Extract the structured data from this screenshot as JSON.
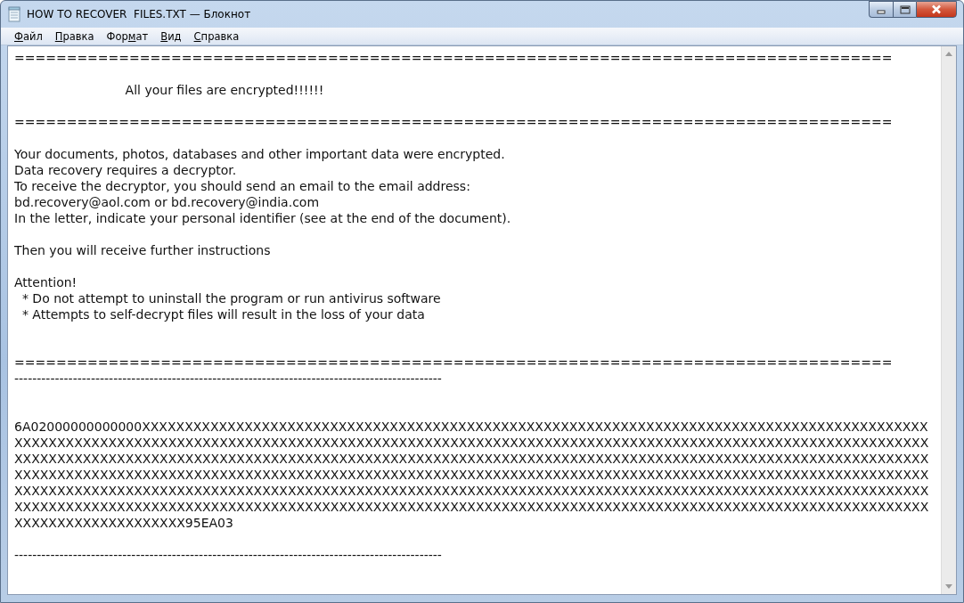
{
  "window": {
    "title": "HOW TO RECOVER  FILES.TXT — Блокнот"
  },
  "menu": [
    {
      "accel": "Ф",
      "rest": "айл"
    },
    {
      "accel": "П",
      "rest": "равка"
    },
    {
      "lead": "Фор",
      "accel": "м",
      "rest": "ат"
    },
    {
      "accel": "В",
      "rest": "ид"
    },
    {
      "accel": "С",
      "rest": "правка"
    }
  ],
  "document": {
    "lines": [
      {
        "kind": "text",
        "text": "===================================================================================="
      },
      {
        "kind": "blank"
      },
      {
        "kind": "text",
        "text": "                            All your files are encrypted!!!!!!"
      },
      {
        "kind": "blank"
      },
      {
        "kind": "text",
        "text": "===================================================================================="
      },
      {
        "kind": "blank"
      },
      {
        "kind": "text",
        "text": "Your documents, photos, databases and other important data were encrypted."
      },
      {
        "kind": "text",
        "text": "Data recovery requires a decryptor."
      },
      {
        "kind": "text",
        "text": "To receive the decryptor, you should send an email to the email address:"
      },
      {
        "kind": "text",
        "text": "bd.recovery@aol.com or bd.recovery@india.com"
      },
      {
        "kind": "text",
        "text": "In the letter, indicate your personal identifier (see at the end of the document)."
      },
      {
        "kind": "blank"
      },
      {
        "kind": "text",
        "text": "Then you will receive further instructions"
      },
      {
        "kind": "blank"
      },
      {
        "kind": "text",
        "text": "Attention!"
      },
      {
        "kind": "text",
        "text": "  * Do not attempt to uninstall the program or run antivirus software"
      },
      {
        "kind": "text",
        "text": "  * Attempts to self-decrypt files will result in the loss of your data"
      },
      {
        "kind": "blank"
      },
      {
        "kind": "blank"
      },
      {
        "kind": "text",
        "text": "===================================================================================="
      },
      {
        "kind": "text",
        "text": "-----------------------------------------------------------------------------------------------"
      },
      {
        "kind": "blank"
      },
      {
        "kind": "blank"
      },
      {
        "kind": "text",
        "text": "6A02000000000000XXXXXXXXXXXXXXXXXXXXXXXXXXXXXXXXXXXXXXXXXXXXXXXXXXXXXXXXXXXXXXXXXXXXXXXXXXXXXXXXXXXXXXXXXXXX"
      },
      {
        "kind": "text",
        "text": "XXXXXXXXXXXXXXXXXXXXXXXXXXXXXXXXXXXXXXXXXXXXXXXXXXXXXXXXXXXXXXXXXXXXXXXXXXXXXXXXXXXXXXXXXXXXXXXXXXXXXXXXXXX"
      },
      {
        "kind": "text",
        "text": "XXXXXXXXXXXXXXXXXXXXXXXXXXXXXXXXXXXXXXXXXXXXXXXXXXXXXXXXXXXXXXXXXXXXXXXXXXXXXXXXXXXXXXXXXXXXXXXXXXXXXXXXXXX"
      },
      {
        "kind": "text",
        "text": "XXXXXXXXXXXXXXXXXXXXXXXXXXXXXXXXXXXXXXXXXXXXXXXXXXXXXXXXXXXXXXXXXXXXXXXXXXXXXXXXXXXXXXXXXXXXXXXXXXXXXXXXXXX"
      },
      {
        "kind": "text",
        "text": "XXXXXXXXXXXXXXXXXXXXXXXXXXXXXXXXXXXXXXXXXXXXXXXXXXXXXXXXXXXXXXXXXXXXXXXXXXXXXXXXXXXXXXXXXXXXXXXXXXXXXXXXXXX"
      },
      {
        "kind": "text",
        "text": "XXXXXXXXXXXXXXXXXXXXXXXXXXXXXXXXXXXXXXXXXXXXXXXXXXXXXXXXXXXXXXXXXXXXXXXXXXXXXXXXXXXXXXXXXXXXXXXXXXXXXXXXXXX"
      },
      {
        "kind": "text",
        "text": "XXXXXXXXXXXXXXXXXXXX95EA03"
      },
      {
        "kind": "blank"
      },
      {
        "kind": "text",
        "text": "-----------------------------------------------------------------------------------------------"
      }
    ]
  }
}
